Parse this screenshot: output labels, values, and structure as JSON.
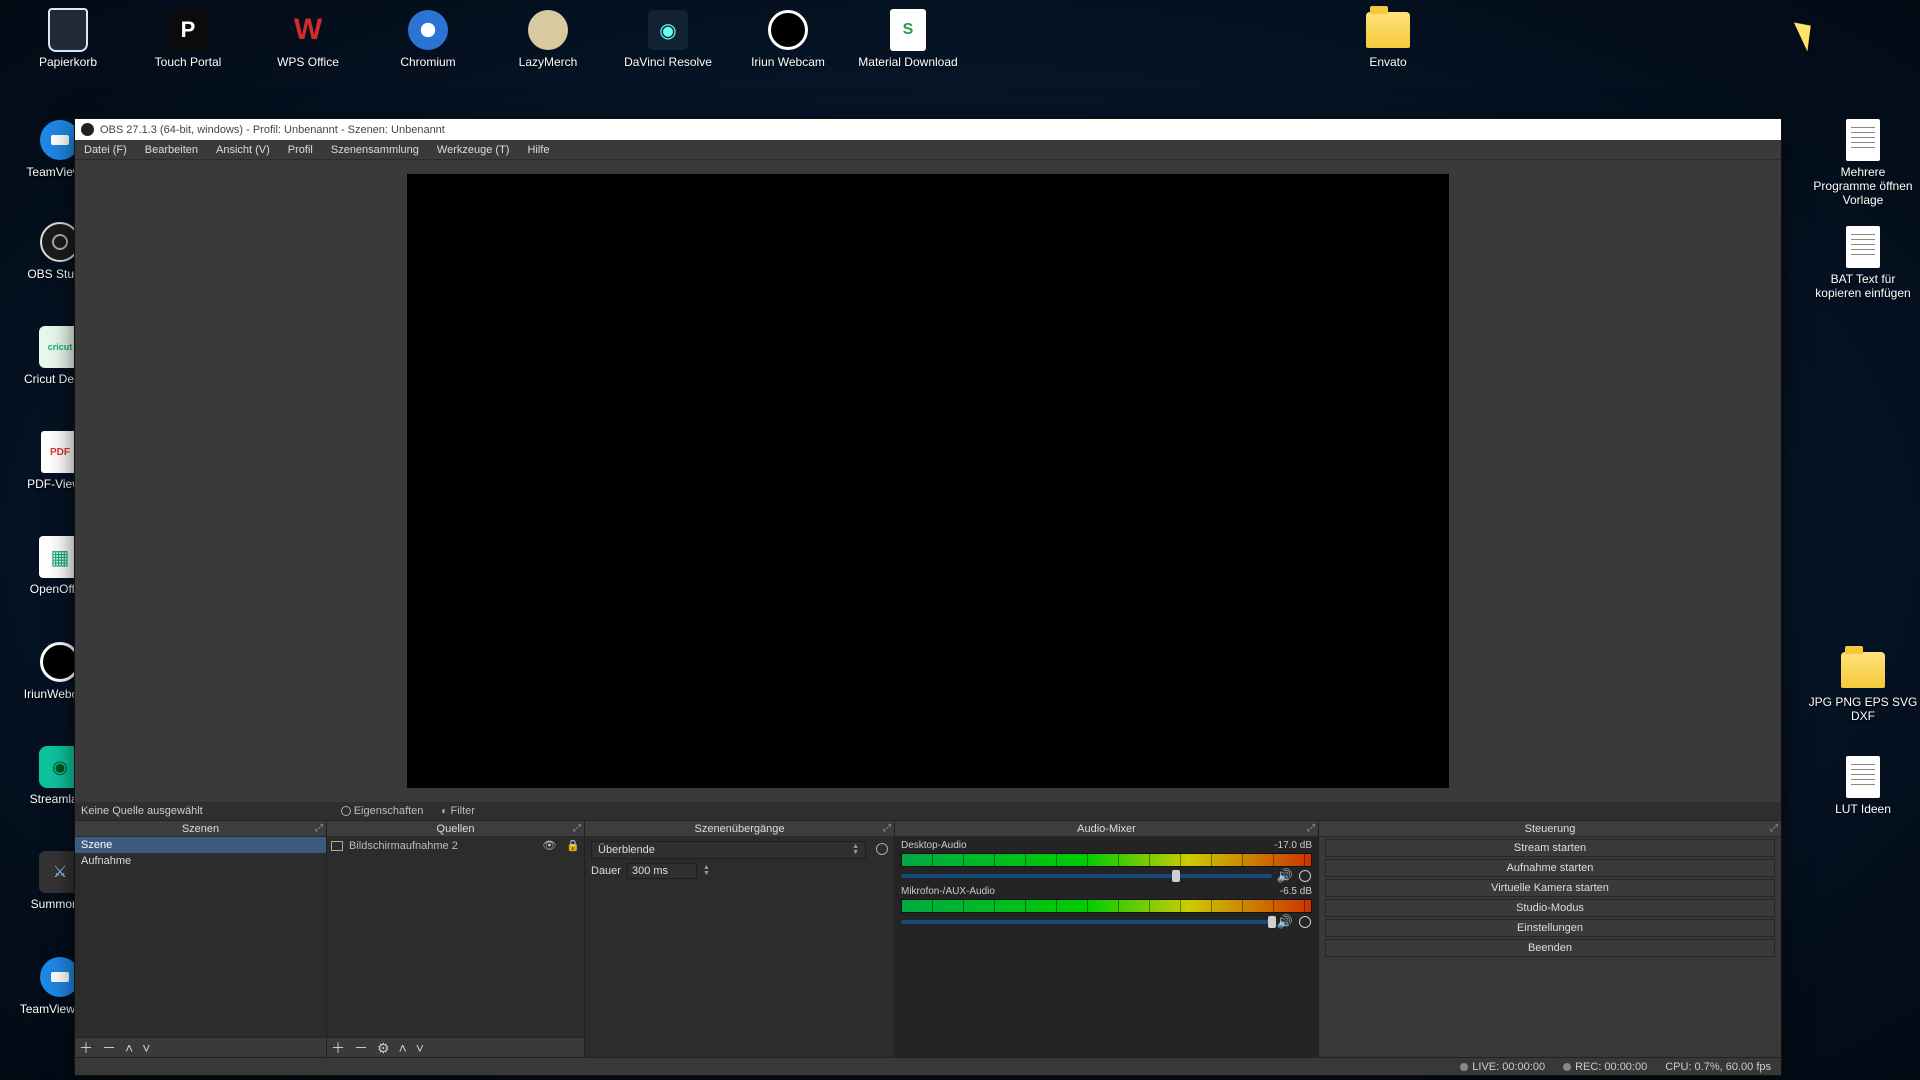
{
  "desktop": {
    "top_row": [
      {
        "name": "papierkorb",
        "label": "Papierkorb",
        "kind": "trash"
      },
      {
        "name": "touch-portal",
        "label": "Touch Portal",
        "kind": "app",
        "bg": "#0b0b0b",
        "fg": "#fff",
        "glyph": "P"
      },
      {
        "name": "wps-office",
        "label": "WPS Office",
        "kind": "app",
        "bg": "#transparent",
        "fg": "#d12b2b",
        "glyph": "W"
      },
      {
        "name": "chromium",
        "label": "Chromium",
        "kind": "circle",
        "bg": "#2b74d4"
      },
      {
        "name": "lazymerch",
        "label": "LazyMerch",
        "kind": "circle",
        "bg": "#d9c9a1"
      },
      {
        "name": "davinci-resolve",
        "label": "DaVinci Resolve",
        "kind": "app",
        "bg": "#134",
        "fg": "#5fd",
        "glyph": "▯"
      },
      {
        "name": "iriun-webcam",
        "label": "Iriun Webcam",
        "kind": "circle",
        "bg": "#000",
        "ring": "#fff"
      },
      {
        "name": "material-download",
        "label": "Material Download",
        "kind": "app",
        "bg": "#fff",
        "fg": "#2a9d4e",
        "glyph": "S"
      },
      {
        "name": "envato",
        "label": "Envato",
        "kind": "folder"
      }
    ],
    "left_col": [
      {
        "name": "teamviewer",
        "label": "TeamView…",
        "kind": "circle",
        "bg": "#1e88e5"
      },
      {
        "name": "obs-studio",
        "label": "OBS Stud…",
        "kind": "circle",
        "bg": "#1b1b1b",
        "ring": "#fff"
      },
      {
        "name": "cricut-design",
        "label": "Cricut Design",
        "kind": "app",
        "bg": "#e6f7ec",
        "fg": "#15b36a",
        "glyph": "cricut"
      },
      {
        "name": "pdf-viewer",
        "label": "PDF-View…",
        "kind": "app",
        "bg": "#fff",
        "fg": "#d33",
        "glyph": "PDF"
      },
      {
        "name": "openoffice",
        "label": "OpenOffice",
        "kind": "app",
        "bg": "#fff",
        "fg": "#1a7",
        "glyph": "▦"
      },
      {
        "name": "iriunwebcam2",
        "label": "IriunWebca…",
        "kind": "circle",
        "bg": "#000",
        "ring": "#fff"
      },
      {
        "name": "streamlabs",
        "label": "Streamlabs",
        "kind": "app",
        "bg": "#0ec3a0",
        "fg": "#052",
        "glyph": "◆"
      },
      {
        "name": "summoner",
        "label": "Summoner",
        "kind": "app",
        "bg": "#333",
        "fg": "#9cf",
        "glyph": "⚔"
      },
      {
        "name": "teamviewer-s",
        "label": "TeamViewer_S",
        "kind": "circle",
        "bg": "#1e88e5"
      }
    ],
    "right_col": [
      {
        "name": "vorlage-doc",
        "label": "Mehrere Programme öffnen Vorlage",
        "kind": "doc"
      },
      {
        "name": "bat-doc",
        "label": "BAT Text für kopieren einfügen",
        "kind": "doc"
      },
      {
        "name": "jpg-folder",
        "label": "JPG PNG EPS SVG DXF",
        "kind": "folder"
      },
      {
        "name": "lut-doc",
        "label": "LUT Ideen",
        "kind": "doc"
      }
    ]
  },
  "obs": {
    "title": "OBS 27.1.3 (64-bit, windows) - Profil: Unbenannt - Szenen: Unbenannt",
    "menu": [
      "Datei (F)",
      "Bearbeiten",
      "Ansicht (V)",
      "Profil",
      "Szenensammlung",
      "Werkzeuge (T)",
      "Hilfe"
    ],
    "toolbar": {
      "no_source": "Keine Quelle ausgewählt",
      "props": "Eigenschaften",
      "filter": "Filter"
    },
    "docks": {
      "scenes": {
        "title": "Szenen",
        "items": [
          "Szene",
          "Aufnahme"
        ]
      },
      "sources": {
        "title": "Quellen",
        "items": [
          {
            "name": "Bildschirmaufnahme 2"
          }
        ]
      },
      "transitions": {
        "title": "Szenenübergänge",
        "selected": "Überblende",
        "duration_label": "Dauer",
        "duration_value": "300 ms"
      },
      "mixer": {
        "title": "Audio-Mixer",
        "channels": [
          {
            "name": "Desktop-Audio",
            "db": "-17.0 dB",
            "thumb": 0.73
          },
          {
            "name": "Mikrofon-/AUX-Audio",
            "db": "-6.5 dB",
            "thumb": 0.99
          }
        ]
      },
      "controls": {
        "title": "Steuerung",
        "buttons": [
          "Stream starten",
          "Aufnahme starten",
          "Virtuelle Kamera starten",
          "Studio-Modus",
          "Einstellungen",
          "Beenden"
        ]
      }
    },
    "status": {
      "live": "LIVE: 00:00:00",
      "rec": "REC: 00:00:00",
      "cpu": "CPU: 0.7%, 60.00 fps"
    }
  }
}
